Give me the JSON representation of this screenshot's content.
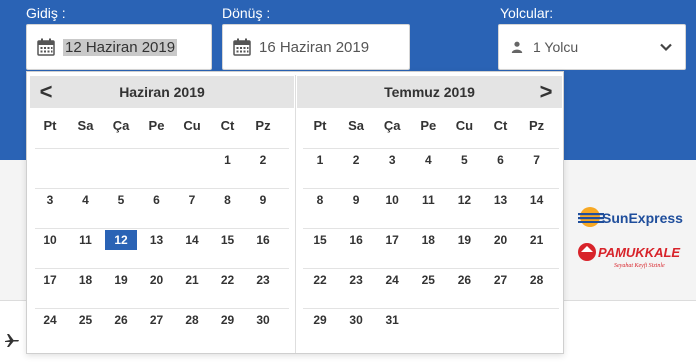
{
  "form": {
    "departure_label": "Gidiş :",
    "departure_value": "12 Haziran 2019",
    "return_label": "Dönüş :",
    "return_value": "16 Haziran 2019",
    "passengers_label": "Yolcular:",
    "passengers_value": "1 Yolcu"
  },
  "calendar": {
    "prev_arrow": "<",
    "next_arrow": ">",
    "weekdays": [
      "Pt",
      "Sa",
      "Ça",
      "Pe",
      "Cu",
      "Ct",
      "Pz"
    ],
    "months": [
      {
        "title": "Haziran 2019",
        "offset": 5,
        "days": 30,
        "selected_day": 12
      },
      {
        "title": "Temmuz 2019",
        "offset": 0,
        "days": 31,
        "selected_day": null
      }
    ]
  },
  "logos": {
    "sunexpress": "SunExpress",
    "pamukkale": "PAMUKKALE",
    "pamukkale_tagline": "Seyahat Keyfi Sizinle"
  },
  "colors": {
    "brand_blue": "#2a63b5",
    "selected_day_bg": "#2a63b5",
    "pamukkale_red": "#d8232a"
  }
}
